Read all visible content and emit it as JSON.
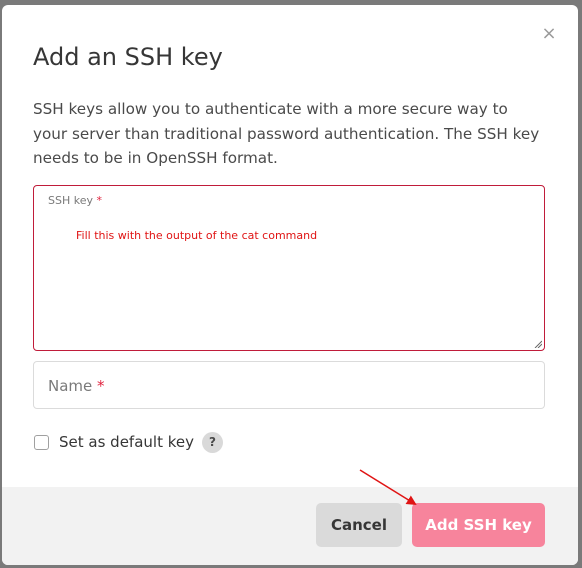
{
  "modal": {
    "close_glyph": "×",
    "title": "Add an SSH key",
    "description": "SSH keys allow you to authenticate with a more secure way to your server than traditional password authentication. The SSH key needs to be in OpenSSH format."
  },
  "ssh_key_field": {
    "label": "SSH key",
    "required_mark": "*",
    "annotation": "Fill this with the output of the cat command"
  },
  "name_field": {
    "placeholder": "Name",
    "required_mark": "*"
  },
  "default_option": {
    "label": "Set as default key",
    "checked": false,
    "help_glyph": "?"
  },
  "footer": {
    "cancel_label": "Cancel",
    "add_label": "Add SSH key"
  },
  "colors": {
    "accent": "#f7849c",
    "error_border": "#c01c3a",
    "annotation_red": "#e01414"
  }
}
